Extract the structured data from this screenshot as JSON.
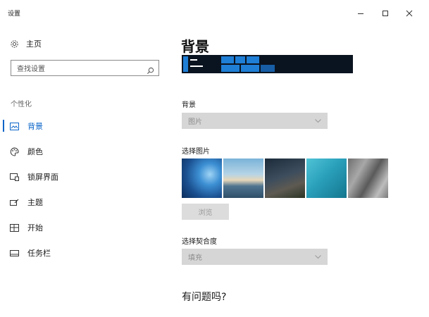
{
  "window": {
    "title": "设置",
    "controls": [
      "minimize-icon",
      "maximize-icon",
      "close-icon"
    ]
  },
  "sidebar": {
    "home": {
      "label": "主页",
      "icon": "gear-icon"
    },
    "search": {
      "placeholder": "查找设置",
      "icon": "search-icon"
    },
    "section_title": "个性化",
    "items": [
      {
        "label": "背景",
        "icon": "image-icon",
        "active": true
      },
      {
        "label": "颜色",
        "icon": "palette-icon",
        "active": false
      },
      {
        "label": "锁屏界面",
        "icon": "lock-screen-icon",
        "active": false
      },
      {
        "label": "主题",
        "icon": "brush-icon",
        "active": false
      },
      {
        "label": "开始",
        "icon": "start-grid-icon",
        "active": false
      },
      {
        "label": "任务栏",
        "icon": "taskbar-icon",
        "active": false
      }
    ]
  },
  "main": {
    "title": "背景",
    "background_label": "背景",
    "background_value": "图片",
    "choose_picture_label": "选择图片",
    "pictures": [
      "windows-blue-light",
      "lake-pier-sky",
      "night-sky-rocks",
      "underwater-sunlight",
      "rock-waterfall-gray"
    ],
    "browse_label": "浏览",
    "fit_label": "选择契合度",
    "fit_value": "填充",
    "help_title": "有问题吗?"
  },
  "colors": {
    "accent": "#0a64c8",
    "disabled_field": "#d6d6d6",
    "preview_background": "#0a1320"
  }
}
